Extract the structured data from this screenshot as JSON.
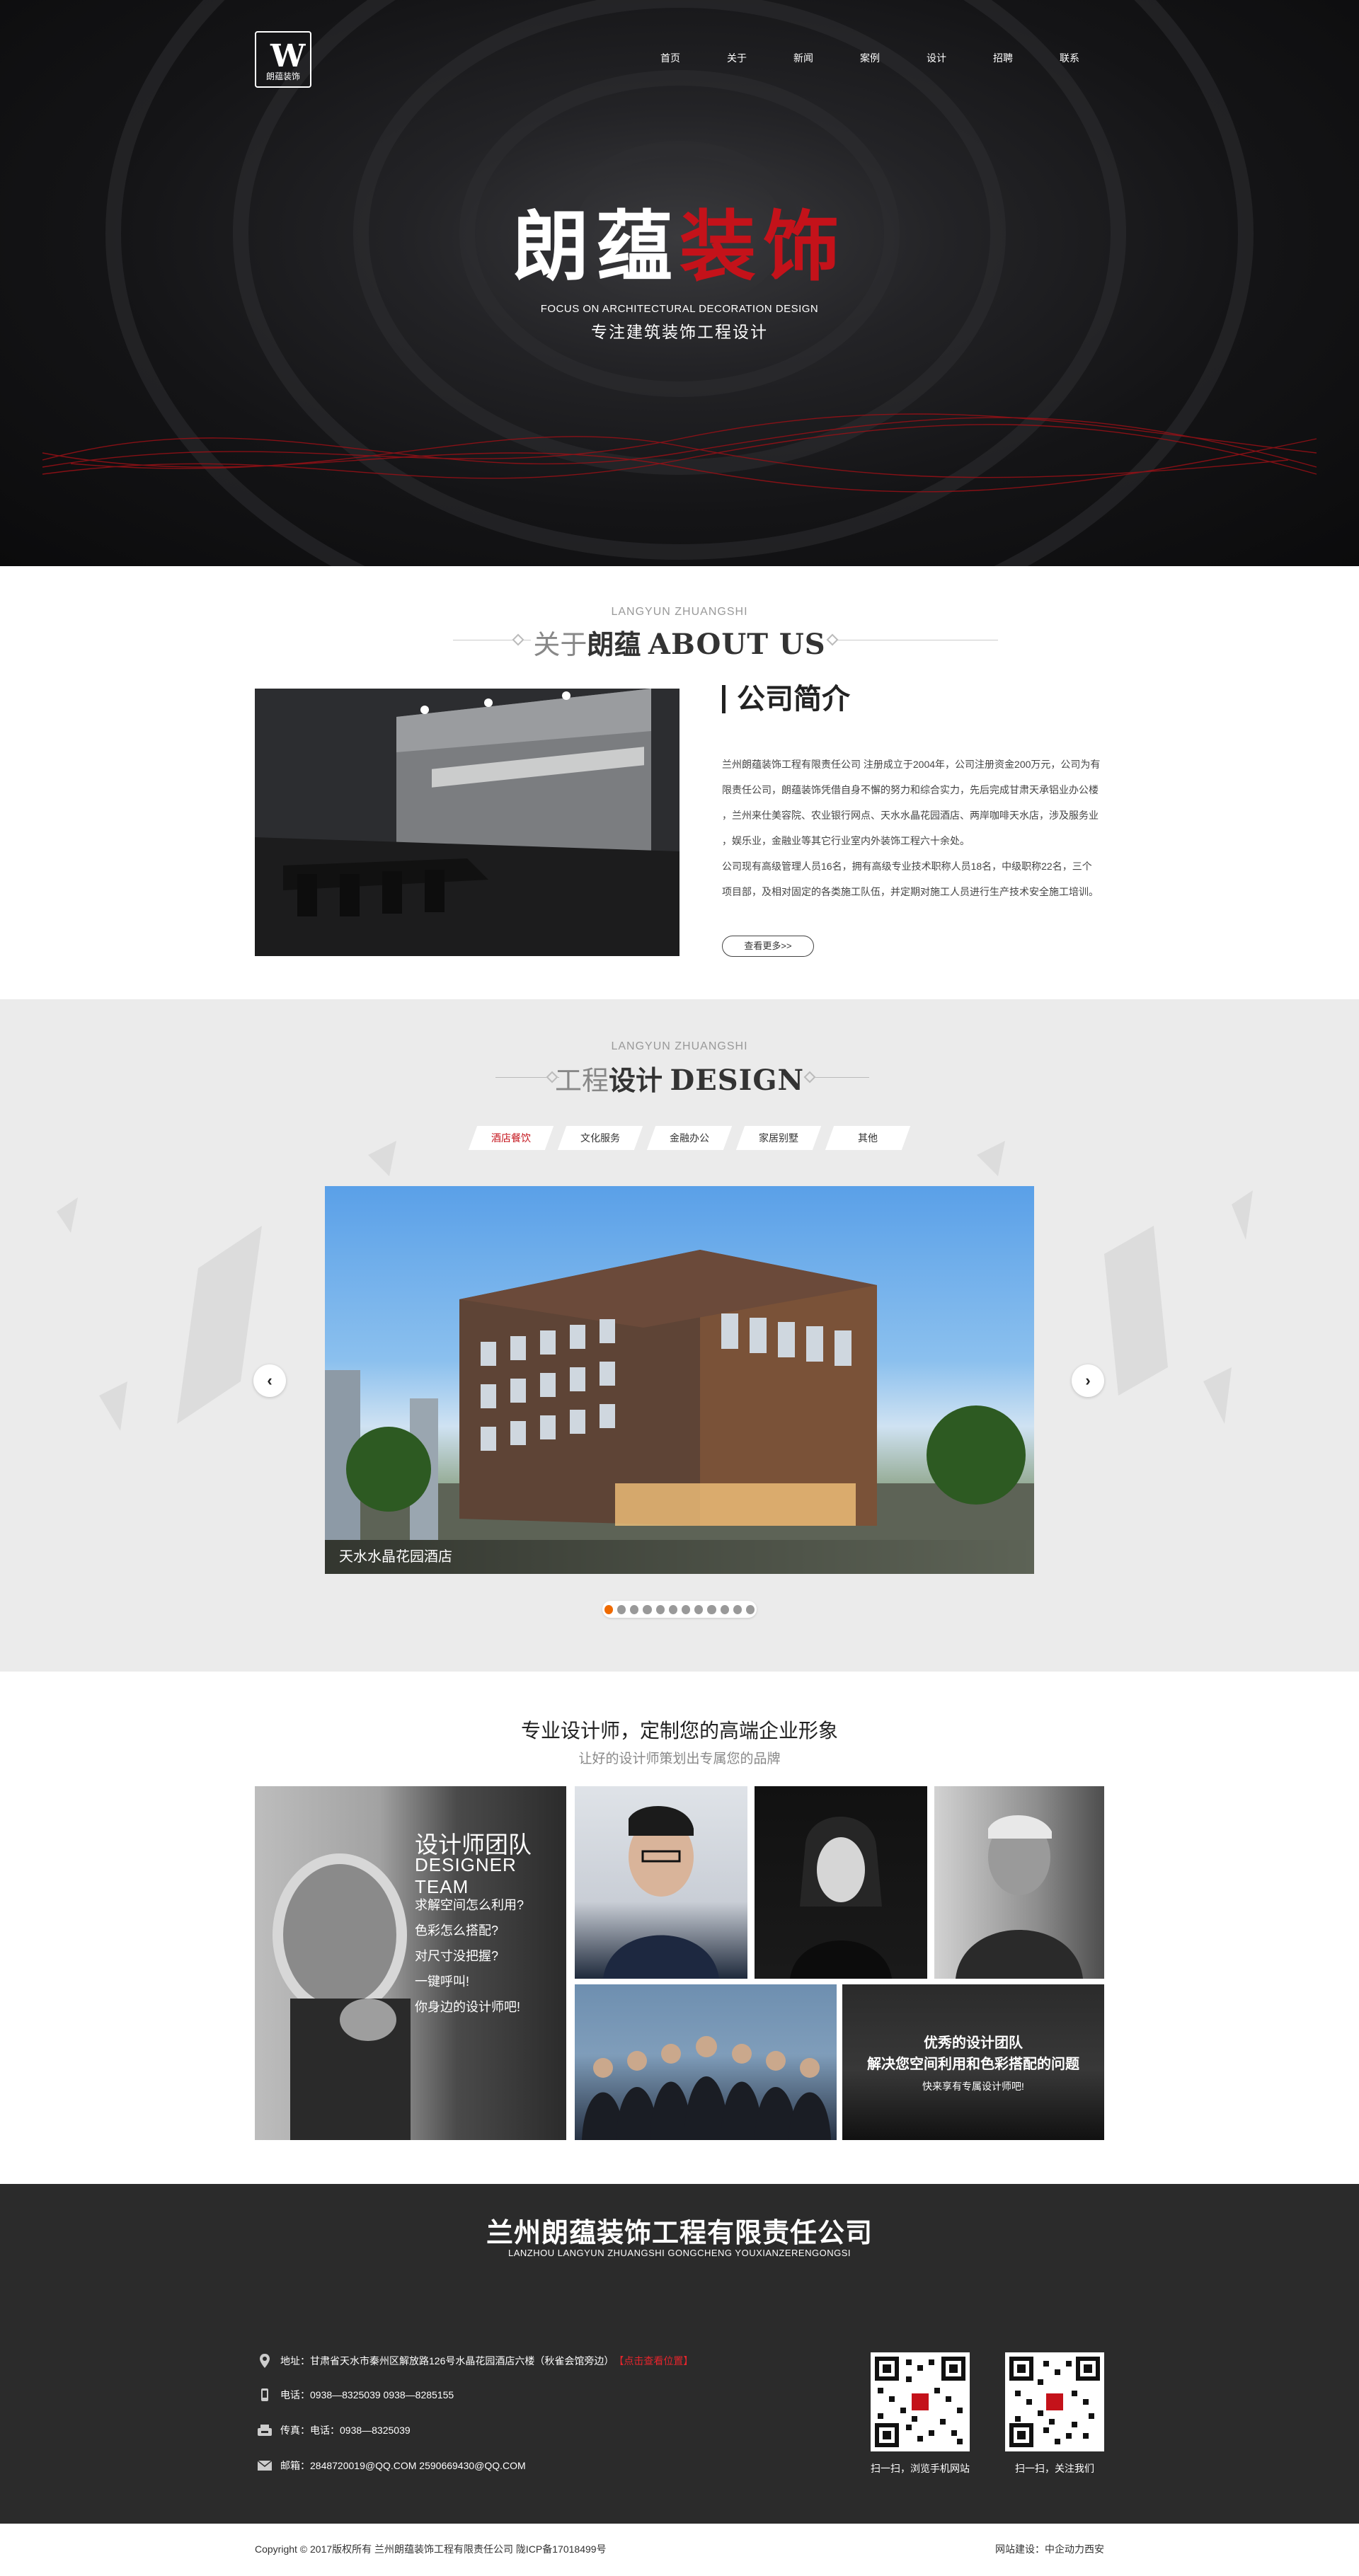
{
  "header": {
    "logo_text": "朗蕴装饰",
    "nav": [
      "首页",
      "关于",
      "新闻",
      "案例",
      "设计",
      "招聘",
      "联系"
    ]
  },
  "hero": {
    "title_white": "朗蕴",
    "title_red": "装饰",
    "subtitle_en": "FOCUS ON ARCHITECTURAL DECORATION DESIGN",
    "subtitle_cn": "专注建筑装饰工程设计"
  },
  "about": {
    "section_en": "LANGYUN ZHUANGSHI",
    "title_light": "关于",
    "title_bold": "朗蕴",
    "title_en": "ABOUT US",
    "heading": "公司简介",
    "lines": [
      "兰州朗蕴装饰工程有限责任公司 注册成立于2004年，公司注册资金200万元，公司为有",
      "限责任公司，朗蕴装饰凭借自身不懈的努力和综合实力，先后完成甘肃天承铝业办公楼",
      "，兰州来仕美容院、农业银行网点、天水水晶花园酒店、两岸咖啡天水店，涉及服务业",
      "，娱乐业，金融业等其它行业室内外装饰工程六十余处。",
      "公司现有高级管理人员16名，拥有高级专业技术职称人员18名，中级职称22名，三个",
      "项目部，及相对固定的各类施工队伍，并定期对施工人员进行生产技术安全施工培训。"
    ],
    "more_button": "查看更多>>"
  },
  "design": {
    "section_en": "LANGYUN ZHUANGSHI",
    "title_light": "工程",
    "title_bold": "设计",
    "title_en": "DESIGN",
    "tabs": [
      "酒店餐饮",
      "文化服务",
      "金融办公",
      "家居别墅",
      "其他"
    ],
    "active_tab": 0,
    "slide_caption": "天水水晶花园酒店",
    "slide_count": 12,
    "active_slide": 0,
    "active_color": "#ef6a00"
  },
  "designers": {
    "title": "专业设计师，定制您的高端企业形象",
    "subtitle": "让好的设计师策划出专属您的品牌",
    "card": {
      "title_cn": "设计师团队",
      "title_en": "DESIGNER TEAM",
      "items": [
        "求解空间怎么利用?",
        "色彩怎么搭配?",
        "对尺寸没把握?",
        "一键呼叫!",
        "你身边的设计师吧!"
      ]
    },
    "team_card": {
      "line1": "优秀的设计团队",
      "line2": "解决您空间利用和色彩搭配的问题",
      "line3": "快来享有专属设计师吧!"
    }
  },
  "footer": {
    "company": "兰州朗蕴装饰工程有限责任公司",
    "company_en": "LANZHOU LANGYUN ZHUANGSHI GONGCHENG YOUXIANZERENGONGSI",
    "address": "地址：甘肃省天水市秦州区解放路126号水晶花园酒店六楼（秋雀会馆旁边）",
    "map_link": "【点击查看位置】",
    "phone": "电话：0938—8325039    0938—8285155",
    "fax": "传真：电话：0938—8325039",
    "email": "邮箱：2848720019@QQ.COM  2590669430@QQ.COM",
    "qr1_caption": "扫一扫，浏览手机网站",
    "qr2_caption": "扫一扫，关注我们",
    "copyright": "Copyright © 2017版权所有    兰州朗蕴装饰工程有限责任公司    陇ICP备17018499号",
    "credit": "网站建设：中企动力西安",
    "accent": "#c4121a"
  }
}
